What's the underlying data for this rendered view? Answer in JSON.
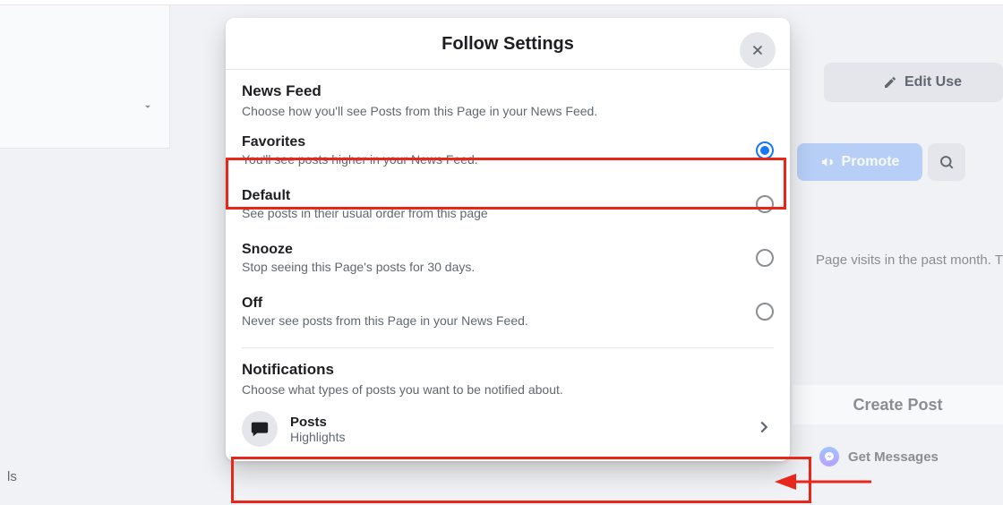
{
  "modal": {
    "title": "Follow Settings",
    "news_feed": {
      "heading": "News Feed",
      "description": "Choose how you'll see Posts from this Page in your News Feed."
    },
    "options": [
      {
        "title": "Favorites",
        "desc": "You'll see posts higher in your News Feed.",
        "selected": true
      },
      {
        "title": "Default",
        "desc": "See posts in their usual order from this page",
        "selected": false
      },
      {
        "title": "Snooze",
        "desc": "Stop seeing this Page's posts for 30 days.",
        "selected": false
      },
      {
        "title": "Off",
        "desc": "Never see posts from this Page in your News Feed.",
        "selected": false
      }
    ],
    "notifications": {
      "heading": "Notifications",
      "description": "Choose what types of posts you want to be notified about."
    },
    "posts_row": {
      "title": "Posts",
      "sub": "Highlights"
    }
  },
  "background": {
    "edit_label": "Edit Use",
    "promote_label": "Promote",
    "visits_text": "Page visits in the past month. T",
    "create_post": "Create Post",
    "get_messages": "Get Messages",
    "left_sidebar_hint": "ls"
  }
}
